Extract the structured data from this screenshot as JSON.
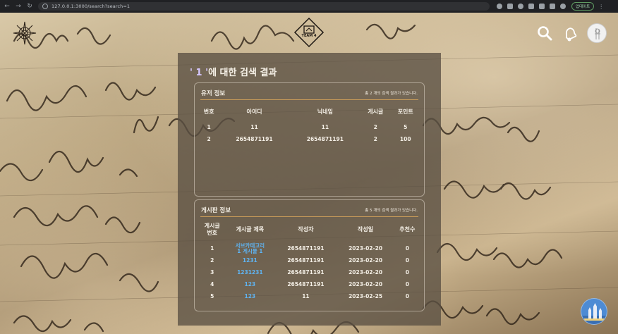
{
  "browser": {
    "url": "127.0.0.1:3000/search?search=1",
    "update_label": "업데이트"
  },
  "site": {
    "logo_text": "TEAM 4"
  },
  "page": {
    "title_prefix": "' 1 '",
    "title_suffix": "에 대한 검색 결과"
  },
  "users": {
    "title": "유저 정보",
    "count_text": "총 2 개의 검색 결과가 있습니다.",
    "headers": [
      "번호",
      "아이디",
      "닉네임",
      "게시글",
      "포인트"
    ],
    "rows": [
      [
        "1",
        "11",
        "11",
        "2",
        "5"
      ],
      [
        "2",
        "2654871191",
        "2654871191",
        "2",
        "100"
      ]
    ]
  },
  "posts": {
    "title": "게시판 정보",
    "count_text": "총 5 개의 검색 결과가 있습니다.",
    "headers": [
      "게시글\n번호",
      "게시글 제목",
      "작성자",
      "작성일",
      "추천수"
    ],
    "rows": [
      [
        "1",
        "서브카테고리\n1 게시물 1",
        "2654871191",
        "2023-02-20",
        "0"
      ],
      [
        "2",
        "1231",
        "2654871191",
        "2023-02-20",
        "0"
      ],
      [
        "3",
        "1231231",
        "2654871191",
        "2023-02-20",
        "0"
      ],
      [
        "4",
        "123",
        "2654871191",
        "2023-02-20",
        "0"
      ],
      [
        "5",
        "123",
        "11",
        "2023-02-25",
        "0"
      ]
    ]
  },
  "colors": {
    "accent_link": "#5fb4f2",
    "divider": "#d8a65a"
  }
}
